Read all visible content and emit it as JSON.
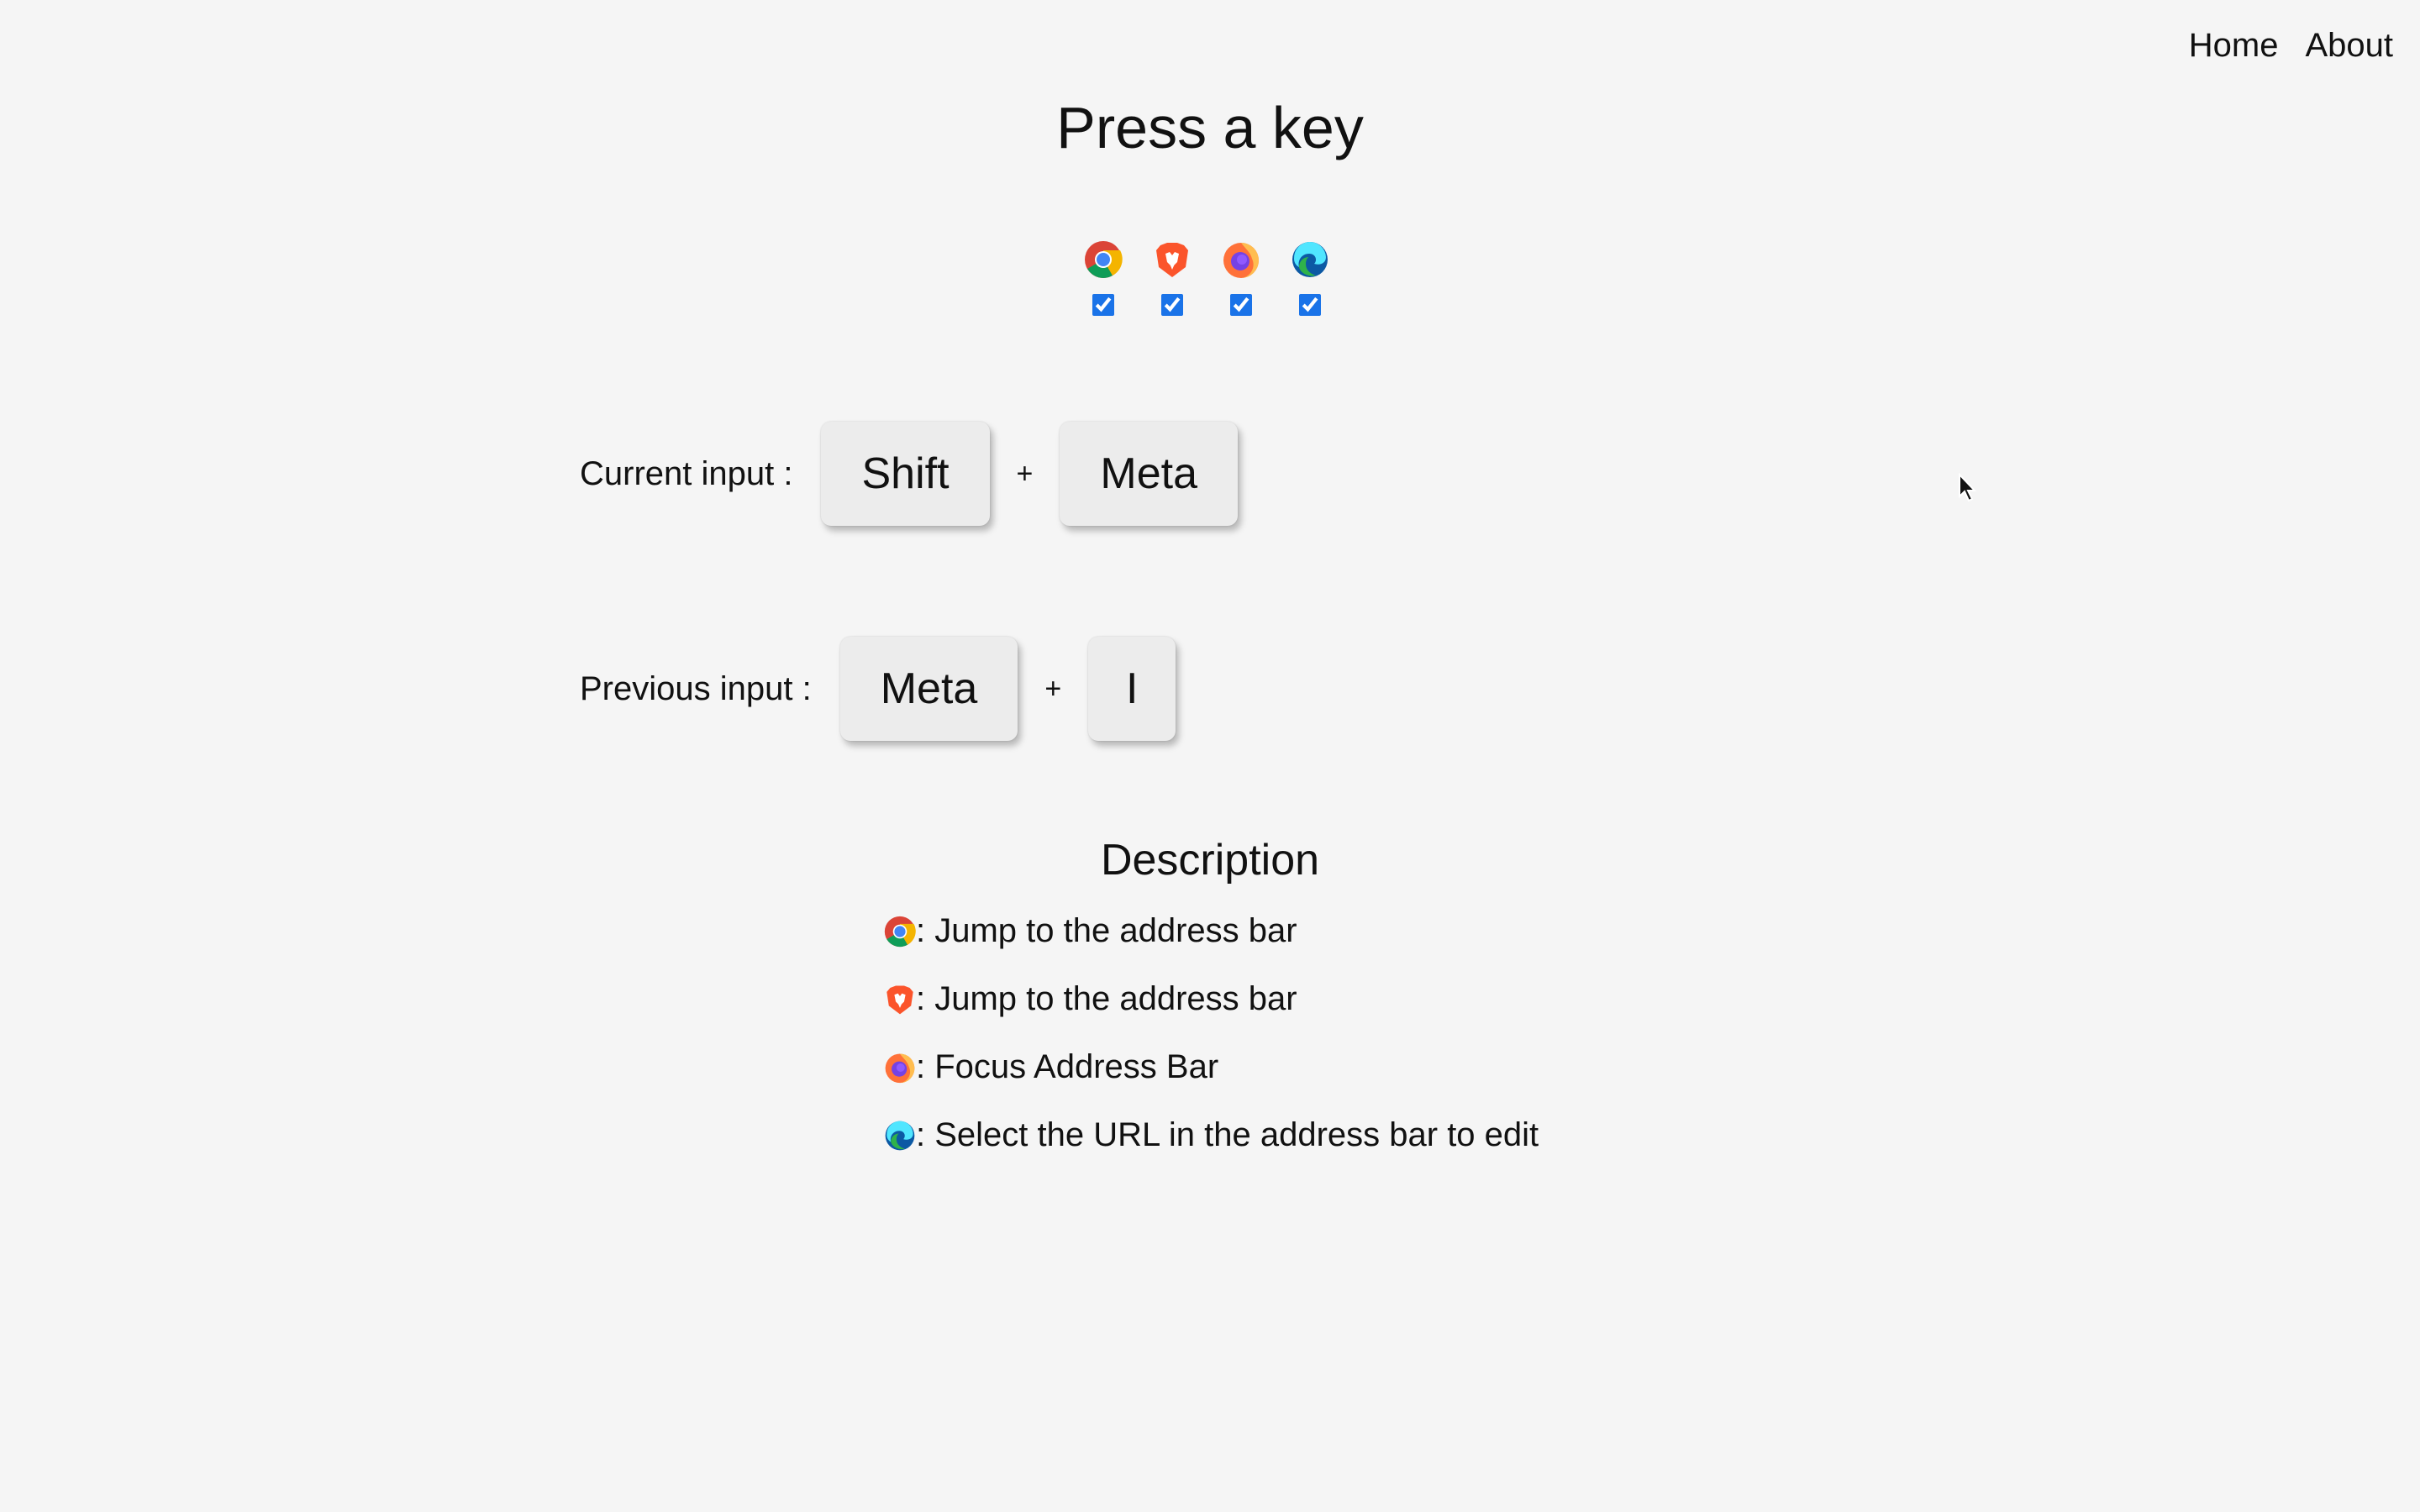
{
  "nav": {
    "home": "Home",
    "about": "About"
  },
  "title": "Press a key",
  "browsers": [
    {
      "icon": "chrome-icon",
      "checked": true
    },
    {
      "icon": "brave-icon",
      "checked": true
    },
    {
      "icon": "firefox-icon",
      "checked": true
    },
    {
      "icon": "edge-icon",
      "checked": true
    }
  ],
  "current_input": {
    "label": "Current input :",
    "keys": [
      "Shift",
      "Meta"
    ],
    "separator": "+"
  },
  "previous_input": {
    "label": "Previous input :",
    "keys": [
      "Meta",
      "I"
    ],
    "separator": "+"
  },
  "description": {
    "title": "Description",
    "items": [
      {
        "icon": "chrome-icon",
        "text": ": Jump to the address bar"
      },
      {
        "icon": "brave-icon",
        "text": ": Jump to the address bar"
      },
      {
        "icon": "firefox-icon",
        "text": ": Focus Address Bar"
      },
      {
        "icon": "edge-icon",
        "text": ": Select the URL in the address bar to edit"
      }
    ]
  },
  "colors": {
    "background": "#f5f5f5",
    "key_background": "#ececec",
    "checkbox_accent": "#1a73e8"
  }
}
